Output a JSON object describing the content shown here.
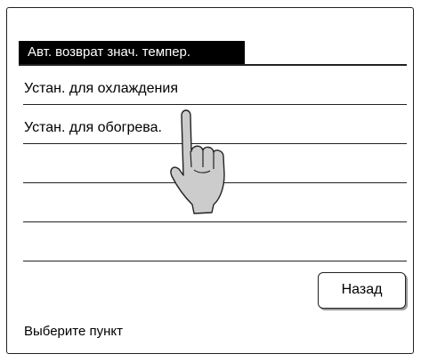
{
  "menu": {
    "header": "Авт. возврат знач. темпер.",
    "items": [
      {
        "label": "Устан. для охлаждения"
      },
      {
        "label": "Устан. для обогрева."
      },
      {
        "label": ""
      },
      {
        "label": ""
      },
      {
        "label": ""
      }
    ]
  },
  "buttons": {
    "back_label": "Назад"
  },
  "status": {
    "prompt": "Выберите пункт"
  },
  "icons": {
    "pointer": "pointing-hand-icon"
  },
  "colors": {
    "background": "#ffffff",
    "header_bg": "#000000",
    "header_text": "#ffffff",
    "hand_fill": "#cccccc"
  }
}
